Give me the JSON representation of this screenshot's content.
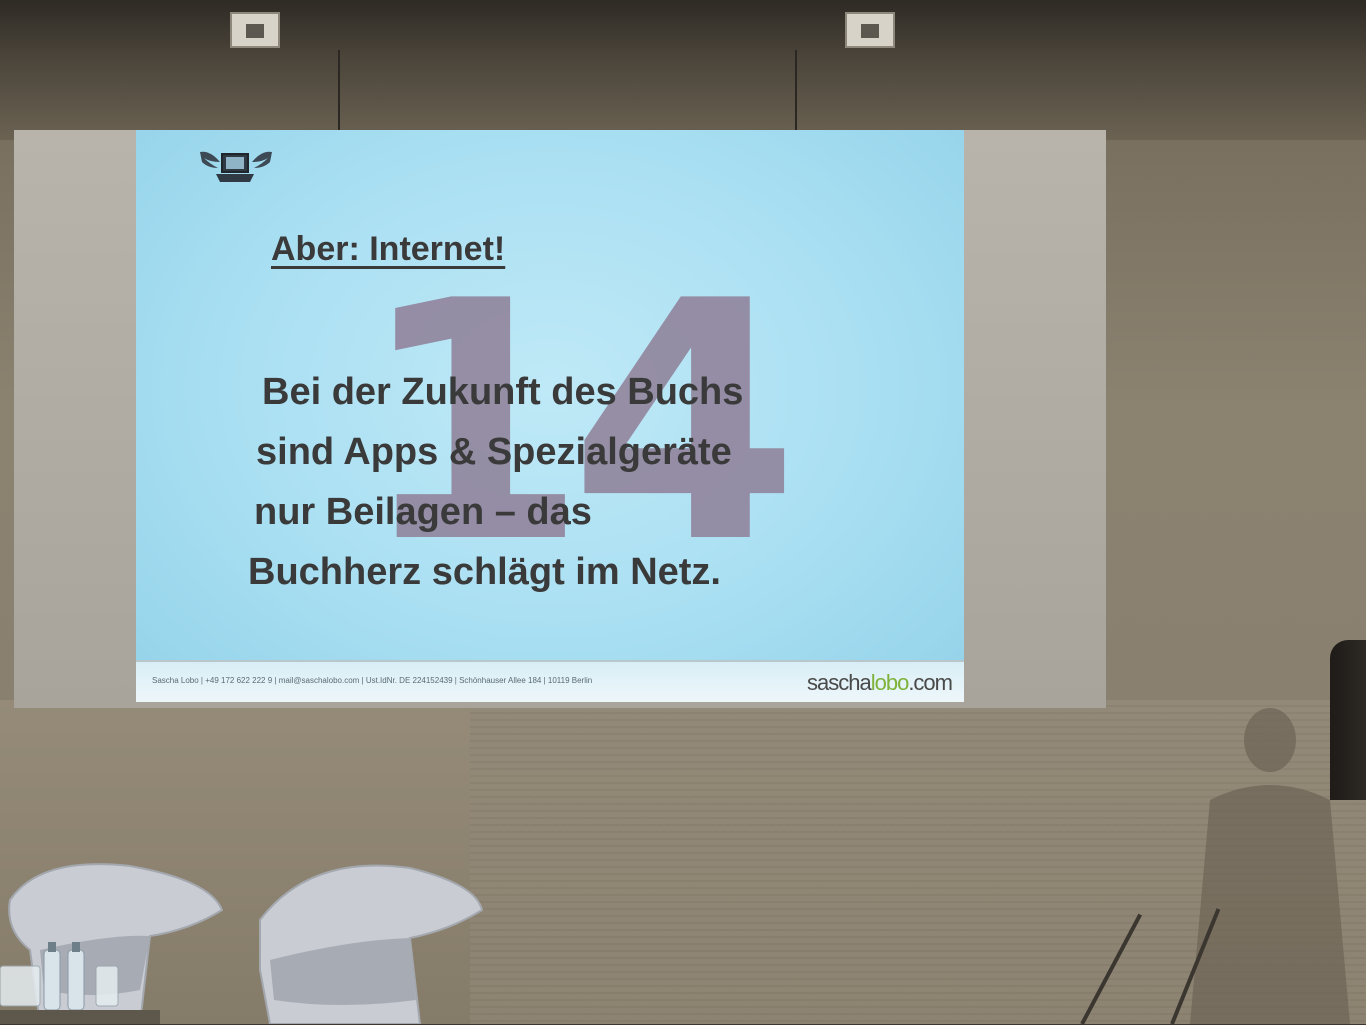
{
  "slide": {
    "heading": "Aber: Internet!",
    "number": "14",
    "body_lines": [
      "Bei der Zukunft des Buchs",
      "sind Apps & Spezialgeräte",
      "nur Beilagen – das",
      "Buchherz schlägt im Netz."
    ],
    "footer_text": "Sascha Lobo | +49 172 622 222 9 | mail@saschalobo.com | Ust.IdNr. DE 224152439 | Schönhauser Allee 184 | 10119 Berlin",
    "footer_brand_main": "sascha",
    "footer_brand_accent": "lobo",
    "footer_brand_tld": ".com",
    "logo_icon": "winged-laptop-icon"
  },
  "colors": {
    "slide_background": "#a9dff2",
    "slide_number": "#8f7f98",
    "slide_text": "#3a3a3a",
    "brand_accent": "#7fb23a",
    "wall": "#8c8270"
  }
}
